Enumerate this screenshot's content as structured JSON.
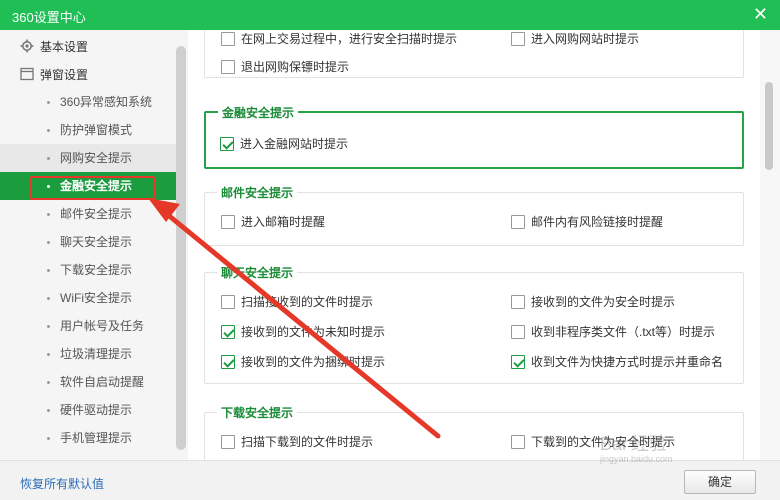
{
  "window": {
    "title": "360设置中心",
    "close": "✕"
  },
  "sidebar": {
    "groups": [
      {
        "label": "基本设置",
        "icon": "gear-icon"
      },
      {
        "label": "弹窗设置",
        "icon": "window-icon"
      }
    ],
    "items": [
      {
        "label": "360异常感知系统"
      },
      {
        "label": "防护弹窗模式"
      },
      {
        "label": "网购安全提示"
      },
      {
        "label": "金融安全提示"
      },
      {
        "label": "邮件安全提示"
      },
      {
        "label": "聊天安全提示"
      },
      {
        "label": "下载安全提示"
      },
      {
        "label": "WiFi安全提示"
      },
      {
        "label": "用户帐号及任务"
      },
      {
        "label": "垃圾清理提示"
      },
      {
        "label": "软件自启动提醒"
      },
      {
        "label": "硬件驱动提示"
      },
      {
        "label": "手机管理提示"
      }
    ],
    "active_item": "金融安全提示"
  },
  "sections": {
    "shopping": {
      "options": [
        {
          "label": "在网上交易过程中，进行安全扫描时提示",
          "checked": false
        },
        {
          "label": "进入网购网站时提示",
          "checked": false
        },
        {
          "label": "退出网购保镖时提示",
          "checked": false
        }
      ]
    },
    "finance": {
      "title": "金融安全提示",
      "options": [
        {
          "label": "进入金融网站时提示",
          "checked": true
        }
      ]
    },
    "mail": {
      "title": "邮件安全提示",
      "options": [
        {
          "label": "进入邮箱时提醒",
          "checked": false
        },
        {
          "label": "邮件内有风险链接时提醒",
          "checked": false
        }
      ]
    },
    "chat": {
      "title": "聊天安全提示",
      "options": [
        {
          "label": "扫描接收到的文件时提示",
          "checked": false
        },
        {
          "label": "接收到的文件为安全时提示",
          "checked": false
        },
        {
          "label": "接收到的文件为未知时提示",
          "checked": true
        },
        {
          "label": "收到非程序类文件（.txt等）时提示",
          "checked": false
        },
        {
          "label": "接收到的文件为捆绑时提示",
          "checked": true
        },
        {
          "label": "收到文件为快捷方式时提示并重命名",
          "checked": true
        }
      ]
    },
    "download": {
      "title": "下载安全提示",
      "options": [
        {
          "label": "扫描下载到的文件时提示",
          "checked": false
        },
        {
          "label": "下载到的文件为安全时提示",
          "checked": false
        }
      ]
    }
  },
  "footer": {
    "reset_label": "恢复所有默认值",
    "ok_label": "确定"
  },
  "watermark": {
    "text": "Bai 经验",
    "sub": "jingyan.baidu.com"
  },
  "colors": {
    "titlebar": "#1fbf56",
    "active": "#1b9c3f",
    "section_title": "#1b8c38",
    "annotation": "#e53828",
    "link": "#2a6db8"
  }
}
